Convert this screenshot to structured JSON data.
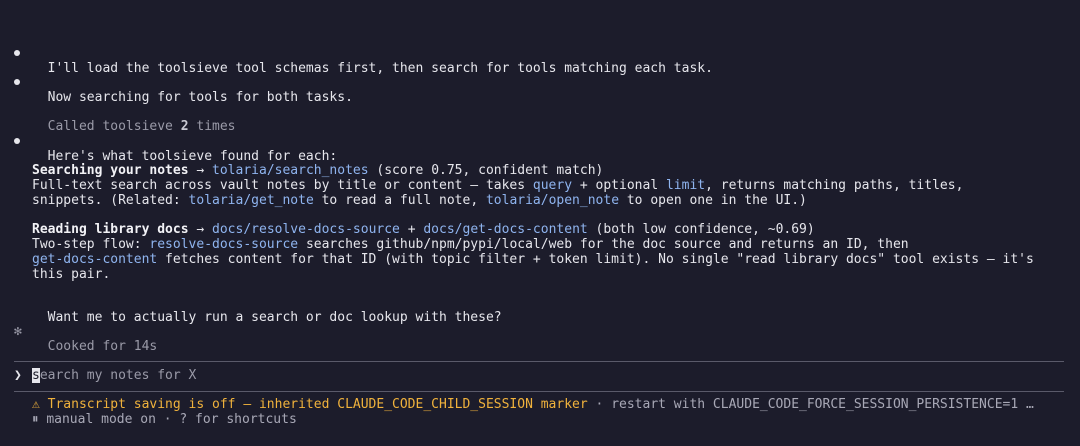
{
  "colors": {
    "background": "#1c1c2b",
    "text": "#e6e6ec",
    "dim": "#9a9aa8",
    "code": "#8fb4ef",
    "warning": "#f0b23c"
  },
  "messages": {
    "m1": "I'll load the toolsieve tool schemas first, then search for tools matching each task.",
    "m2": "Now searching for tools for both tasks.",
    "tool_call": {
      "prefix": "Called toolsieve ",
      "count": "2",
      "suffix": " times"
    },
    "m3": "Here's what toolsieve found for each:",
    "section1": {
      "heading": "Searching your notes",
      "arrow": " → ",
      "tool": "tolaria/search_notes",
      "meta": " (score 0.75, confident match)",
      "line2_a": "Full-text search across vault notes by title or content — takes ",
      "line2_query": "query",
      "line2_b": " + optional ",
      "line2_limit": "limit",
      "line2_c": ", returns matching paths, titles,",
      "line3_a": "snippets. (Related: ",
      "line3_get": "tolaria/get_note",
      "line3_b": " to read a full note, ",
      "line3_open": "tolaria/open_note",
      "line3_c": " to open one in the UI.)"
    },
    "section2": {
      "heading": "Reading library docs",
      "arrow": " → ",
      "tool1": "docs/resolve-docs-source",
      "plus": " + ",
      "tool2": "docs/get-docs-content",
      "meta": " (both low confidence, ~0.69)",
      "line2_a": "Two-step flow: ",
      "line2_tool": "resolve-docs-source",
      "line2_b": " searches github/npm/pypi/local/web for the doc source and returns an ID, then",
      "line3_tool": "get-docs-content",
      "line3_b": " fetches content for that ID (with topic filter + token limit). No single \"read library docs\" tool exists — it's",
      "line4": "this pair."
    },
    "closing": "Want me to actually run a search or doc lookup with these?",
    "cooked": "Cooked for 14s"
  },
  "input": {
    "cursor_char": "s",
    "placeholder_rest": "earch my notes for X"
  },
  "footer": {
    "warning": "⚠ Transcript saving is off — inherited CLAUDE_CODE_CHILD_SESSION marker",
    "sep": " · ",
    "restart": "restart with CLAUDE_CODE_FORCE_SESSION_PERSISTENCE=1 …",
    "mode": "⏸ manual mode on",
    "shortcuts": " · ? for shortcuts"
  }
}
